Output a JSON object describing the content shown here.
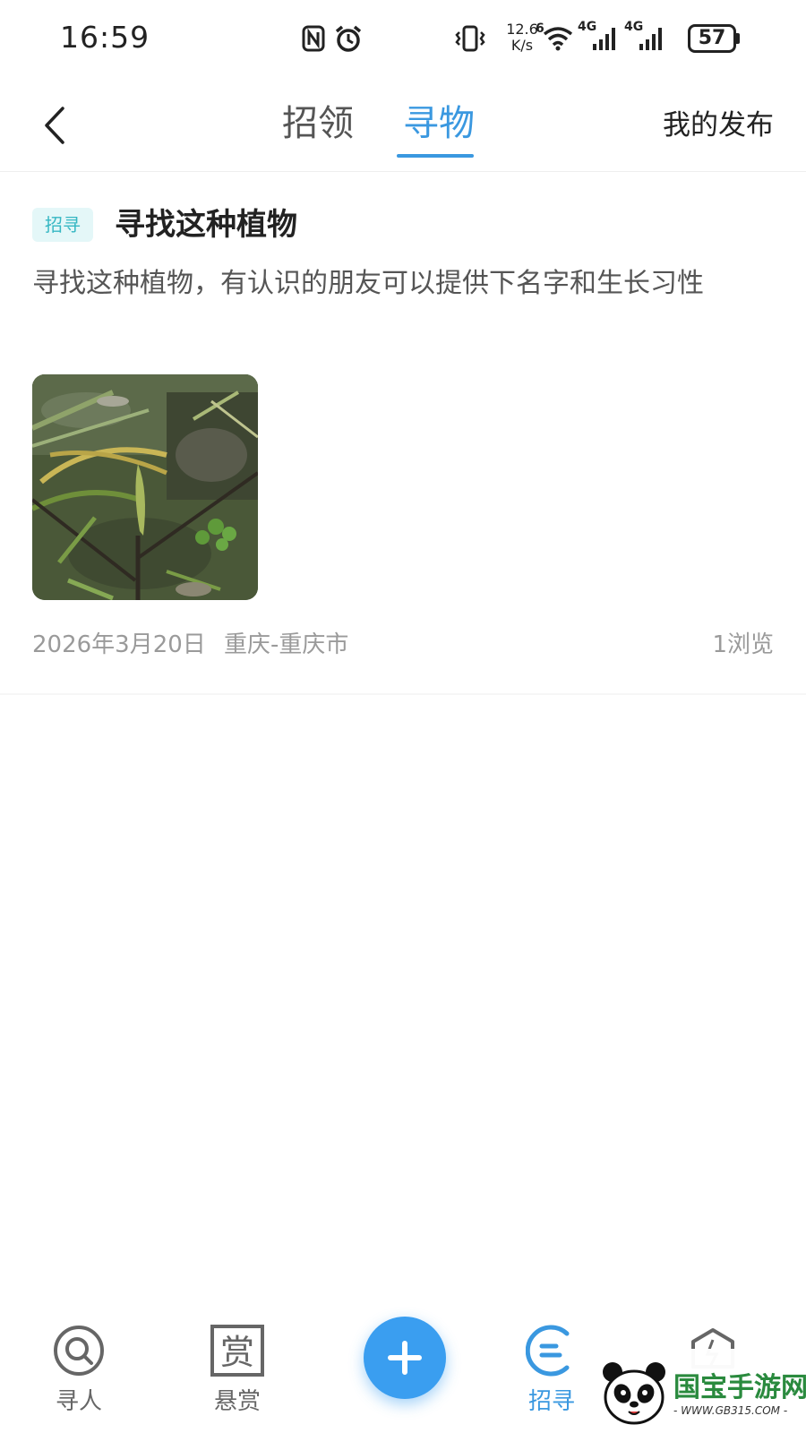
{
  "status_bar": {
    "time": "16:59",
    "net_speed_value": "12.6",
    "net_speed_unit": "K/s",
    "wifi_badge": "6",
    "signal1_label": "4G",
    "signal2_label": "4G",
    "battery_level": "57",
    "icons": [
      "nfc-icon",
      "alarm-icon",
      "vibrate-icon",
      "wifi-icon",
      "signal-icon",
      "signal-icon",
      "battery-icon"
    ]
  },
  "header": {
    "tabs": [
      {
        "label": "招领",
        "active": false
      },
      {
        "label": "寻物",
        "active": true
      }
    ],
    "my_posts_label": "我的发布",
    "accent_color": "#3a98e0"
  },
  "post": {
    "tag": "招寻",
    "title": "寻找这种植物",
    "description": "寻找这种植物，有认识的朋友可以提供下名字和生长习性",
    "date": "2026年3月20日",
    "location": "重庆-重庆市",
    "views": "1浏览"
  },
  "bottom_nav": {
    "items": [
      {
        "label": "寻人",
        "icon": "search-person-icon",
        "active": false
      },
      {
        "label": "悬赏",
        "icon": "reward-icon",
        "active": false
      },
      {
        "label": "招寻",
        "icon": "lost-found-icon",
        "active": true
      },
      {
        "label": "",
        "icon": "profile-shield-icon",
        "active": false
      }
    ],
    "fab_icon": "plus-icon"
  },
  "watermark": {
    "text": "国宝手游网",
    "url": "- WWW.GB315.COM -"
  }
}
